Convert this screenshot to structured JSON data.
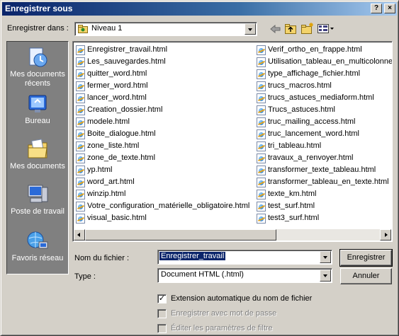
{
  "window": {
    "title": "Enregistrer sous",
    "help_glyph": "?",
    "close_glyph": "×"
  },
  "toolbar": {
    "save_in_label": "Enregistrer dans :",
    "save_in_value": "Niveau 1"
  },
  "places": [
    {
      "label": "Mes documents récents",
      "icon": "recent-documents-icon"
    },
    {
      "label": "Bureau",
      "icon": "desktop-icon"
    },
    {
      "label": "Mes documents",
      "icon": "my-documents-icon"
    },
    {
      "label": "Poste de travail",
      "icon": "my-computer-icon"
    },
    {
      "label": "Favoris réseau",
      "icon": "network-places-icon"
    }
  ],
  "files_col1": [
    "Enregistrer_travail.html",
    "Les_sauvegardes.html",
    "quitter_word.html",
    "fermer_word.html",
    "lancer_word.html",
    "Creation_dossier.html",
    "modele.html",
    "Boite_dialogue.html",
    "zone_liste.html",
    "zone_de_texte.html",
    "yp.html",
    "word_art.html",
    "winzip.html",
    "Votre_configuration_matérielle_obligatoire.html",
    "visual_basic.html"
  ],
  "files_col2": [
    "Verif_ortho_en_frappe.html",
    "Utilisation_tableau_en_multicolonnes.html",
    "type_affichage_fichier.html",
    "trucs_macros.html",
    "trucs_astuces_mediaform.html",
    "Trucs_astuces.html",
    "truc_mailing_access.html",
    "truc_lancement_word.html",
    "tri_tableau.html",
    "travaux_a_renvoyer.html",
    "transformer_texte_tableau.html",
    "transformer_tableau_en_texte.html",
    "texte_km.html",
    "test_surf.html",
    "test3_surf.html"
  ],
  "form": {
    "filename_label": "Nom du fichier :",
    "filename_value": "Enregistrer_travail",
    "type_label": "Type :",
    "type_value": "Document HTML (.html)",
    "save_button": "Enregistrer",
    "cancel_button": "Annuler"
  },
  "options": {
    "auto_ext_label": "Extension automatique du nom de fichier",
    "auto_ext_checked": true,
    "password_label": "Enregistrer avec mot de passe",
    "filter_label": "Éditer les paramètres de filtre"
  },
  "colors": {
    "title_bar": "#0a246a",
    "dialog_bg": "#d4d0c8",
    "places_bg": "#808080"
  }
}
